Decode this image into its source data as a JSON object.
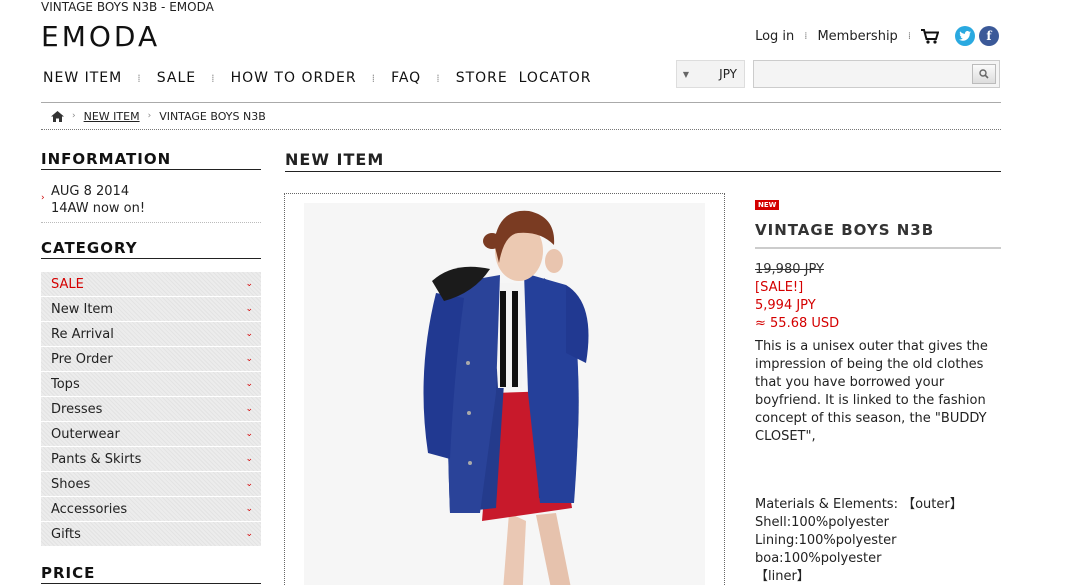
{
  "window_title": "VINTAGE BOYS N3B - EMODA",
  "brand": "EMODA",
  "header": {
    "login": "Log in",
    "membership": "Membership"
  },
  "nav": {
    "new_item": "NEW ITEM",
    "sale": "SALE",
    "how_to_order": "HOW TO ORDER",
    "faq": "FAQ",
    "store_locator": "STORE  LOCATOR"
  },
  "currency": {
    "selected": "JPY"
  },
  "search": {
    "value": ""
  },
  "breadcrumb": {
    "link": "NEW ITEM",
    "current": "VINTAGE BOYS N3B"
  },
  "sidebar": {
    "information_title": "INFORMATION",
    "info_items": [
      {
        "date": "AUG 8 2014",
        "text": "14AW now on!"
      }
    ],
    "category_title": "CATEGORY",
    "categories": [
      "SALE",
      "New Item",
      "Re Arrival",
      "Pre Order",
      "Tops",
      "Dresses",
      "Outerwear",
      "Pants & Skirts",
      "Shoes",
      "Accessories",
      "Gifts"
    ],
    "price_title": "PRICE"
  },
  "main": {
    "section_title": "NEW ITEM"
  },
  "product": {
    "badge": "NEW",
    "name": "VINTAGE BOYS N3B",
    "original_price": "19,980 JPY",
    "sale_label": "[SALE!]",
    "sale_price": "5,994 JPY",
    "usd_price": "≈ 55.68 USD",
    "description": "This is a unisex outer that gives the impression of being the old clothes that you have borrowed your boyfriend. It is linked to the fashion concept of this season, the \"BUDDY CLOSET\",",
    "materials": "Materials & Elements: 【outer】\nShell:100%polyester\nLining:100%polyester\nboa:100%polyester\n【liner】"
  },
  "colors": {
    "accent_red": "#d40000",
    "twitter": "#2aa9e0",
    "facebook": "#3b5998"
  },
  "icons": [
    "home-icon",
    "cart-icon",
    "twitter-icon",
    "facebook-icon",
    "search-icon",
    "chevron-down-icon"
  ]
}
